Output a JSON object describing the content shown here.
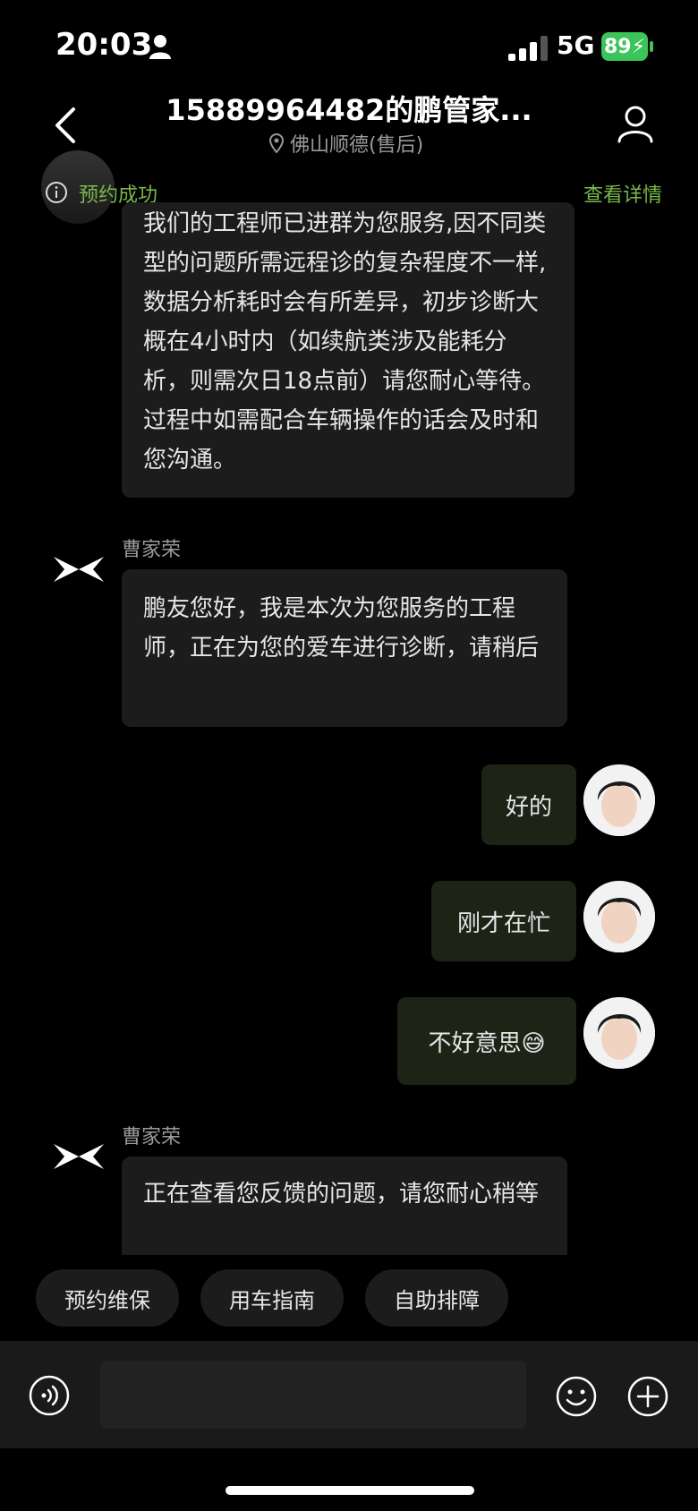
{
  "status_bar": {
    "time": "20:03",
    "network": "5G",
    "battery": "89"
  },
  "header": {
    "title": "15889964482的鹏管家...",
    "subtitle": "佛山顺德(售后)"
  },
  "appointment": {
    "status": "预约成功",
    "detail_link": "查看详情"
  },
  "messages": [
    {
      "direction": "in",
      "sender": "",
      "text": "我们的工程师已进群为您服务,因不同类型的问题所需远程诊的复杂程度不一样,数据分析耗时会有所差异，初步诊断大概在4小时内（如续航类涉及能耗分析，则需次日18点前）请您耐心等待。过程中如需配合车辆操作的话会及时和您沟通。"
    },
    {
      "direction": "in",
      "sender": "曹家荣",
      "text": "鹏友您好，我是本次为您服务的工程师，正在为您的爱车进行诊断，请稍后"
    },
    {
      "direction": "out",
      "text": "好的"
    },
    {
      "direction": "out",
      "text": "刚才在忙"
    },
    {
      "direction": "out",
      "text": "不好意思😅"
    },
    {
      "direction": "in",
      "sender": "曹家荣",
      "text": "正在查看您反馈的问题，请您耐心稍等"
    }
  ],
  "quick_replies": [
    "预约维保",
    "用车指南",
    "自助排障"
  ],
  "input": {
    "placeholder": ""
  },
  "colors": {
    "accent_green": "#79b84b",
    "outgoing_bubble": "#1d2416",
    "incoming_bubble": "#1c1c1c"
  }
}
